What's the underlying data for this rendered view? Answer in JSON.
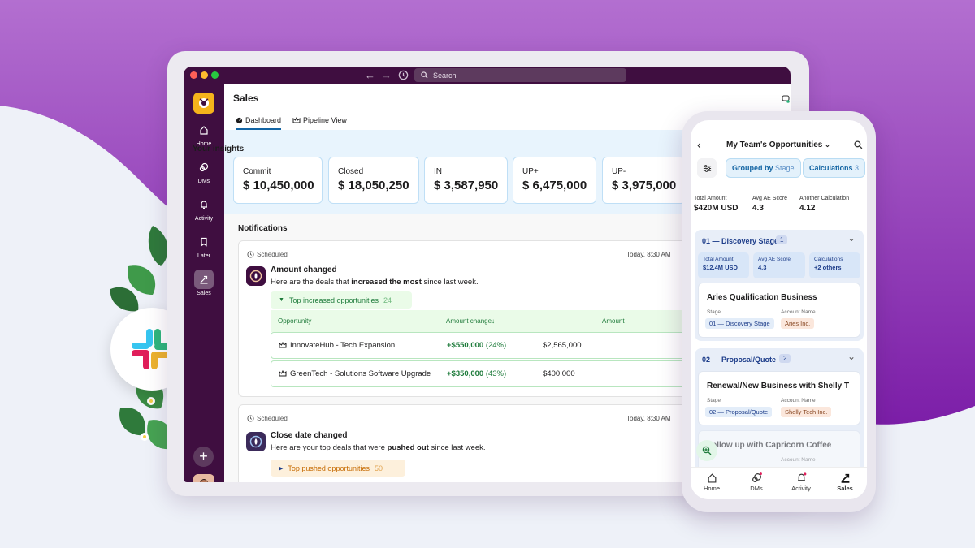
{
  "colors": {
    "aubergine": "#3f0e40",
    "purple_bg": "#8b2fb8",
    "accent_blue": "#1264a3",
    "green": "#1e7b3b",
    "orange": "#c66a00"
  },
  "browser": {
    "search_placeholder": "Search"
  },
  "sidebar": {
    "items": [
      {
        "label": "Home",
        "icon": "home-icon"
      },
      {
        "label": "DMs",
        "icon": "dms-icon"
      },
      {
        "label": "Activity",
        "icon": "bell-icon"
      },
      {
        "label": "Later",
        "icon": "bookmark-icon"
      },
      {
        "label": "Sales",
        "icon": "sales-icon",
        "active": true
      }
    ]
  },
  "main": {
    "title": "Sales",
    "tabs": [
      {
        "label": "Dashboard",
        "active": true
      },
      {
        "label": "Pipeline View",
        "active": false
      }
    ],
    "insights_title": "Your insights",
    "metrics": [
      {
        "label": "Commit",
        "value": "$ 10,450,000"
      },
      {
        "label": "Closed",
        "value": "$ 18,050,250"
      },
      {
        "label": "IN",
        "value": "$ 3,587,950"
      },
      {
        "label": "UP+",
        "value": "$ 6,475,000"
      },
      {
        "label": "UP-",
        "value": "$ 3,975,000"
      }
    ],
    "notifications_title": "Notifications",
    "cards": [
      {
        "scheduled": "Scheduled",
        "time": "Today, 8:30 AM",
        "title": "Amount changed",
        "sub_before": "Here are the deals that ",
        "sub_bold": "increased the most",
        "sub_after": " since last week.",
        "pill_label": "Top increased opportunities",
        "pill_count": "24",
        "columns": [
          "Opportunity",
          "Amount change↓",
          "Amount"
        ],
        "rows": [
          {
            "name": "InnovateHub - Tech Expansion",
            "change": "+$550,000",
            "pct": "(24%)",
            "amount": "$2,565,000"
          },
          {
            "name": "GreenTech - Solutions Software Upgrade",
            "change": "+$350,000",
            "pct": "(43%)",
            "amount": "$400,000"
          }
        ]
      },
      {
        "scheduled": "Scheduled",
        "time": "Today, 8:30 AM",
        "title": "Close date changed",
        "sub_before": "Here are your top deals that were ",
        "sub_bold": "pushed out",
        "sub_after": " since last week.",
        "pill_label": "Top pushed opportunities",
        "pill_count": "50"
      }
    ]
  },
  "phone": {
    "title": "My Team's Opportunities",
    "chips": [
      {
        "prefix": "Grouped by",
        "value": "Stage"
      },
      {
        "prefix": "Calculations",
        "value": "3"
      }
    ],
    "summary": [
      {
        "label": "Total Amount",
        "value": "$420M USD"
      },
      {
        "label": "Avg AE Score",
        "value": "4.3"
      },
      {
        "label": "Another Calculation",
        "value": "4.12"
      }
    ],
    "groups": [
      {
        "title": "01 — Discovery Stage",
        "count": "1",
        "minis": [
          {
            "a": "Total Amount",
            "b": "$12.4M USD"
          },
          {
            "a": "Avg AE Score",
            "b": "4.3"
          },
          {
            "a": "Calculations",
            "b": "+2 others"
          }
        ],
        "deal": {
          "title": "Aries Qualification Business",
          "stage_label": "Stage",
          "stage": "01 — Discovery Stage",
          "account_label": "Account Name",
          "account": "Aries Inc."
        }
      },
      {
        "title": "02 — Proposal/Quote",
        "count": "2",
        "deal": {
          "title": "Renewal/New Business with Shelly T",
          "stage_label": "Stage",
          "stage": "02 — Proposal/Quote",
          "account_label": "Account Name",
          "account": "Shelly Tech Inc."
        },
        "deal2": {
          "title": "Follow up with Capricorn Coffee",
          "account_label": "Account Name"
        }
      }
    ],
    "nav": [
      "Home",
      "DMs",
      "Activity",
      "Sales"
    ]
  }
}
